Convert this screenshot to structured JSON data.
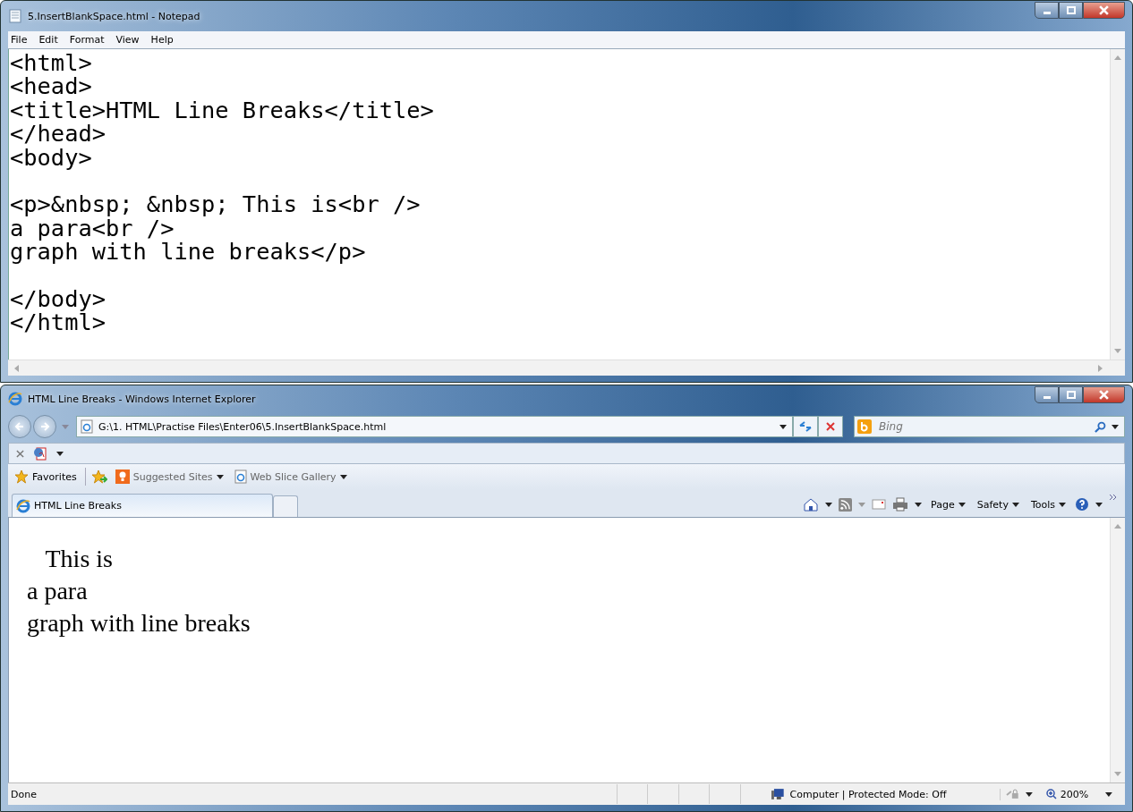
{
  "notepad": {
    "title": "5.InsertBlankSpace.html - Notepad",
    "menu": [
      "File",
      "Edit",
      "Format",
      "View",
      "Help"
    ],
    "code_blocks": [
      [
        "<html>",
        "<head>",
        "<title>HTML Line Breaks</title>",
        "</head>",
        "<body>"
      ],
      [
        "<p>&nbsp; &nbsp; This is<br />",
        "a para<br />",
        "graph with line breaks</p>"
      ],
      [
        "</body>",
        "</html>"
      ]
    ]
  },
  "browser": {
    "title": "HTML Line Breaks - Windows Internet Explorer",
    "address": "G:\\1. HTML\\Practise Files\\Enter06\\5.InsertBlankSpace.html",
    "search": {
      "placeholder": "Bing"
    },
    "favorites": {
      "label": "Favorites",
      "links": [
        "Suggested Sites",
        "Web Slice Gallery"
      ]
    },
    "tabs": [
      {
        "label": "HTML Line Breaks",
        "selected": true
      }
    ],
    "commands": [
      "Page",
      "Safety",
      "Tools"
    ],
    "content_lines": [
      "   This is",
      "a para",
      "graph with line breaks"
    ],
    "status": {
      "text": "Done",
      "zone": "Computer | Protected Mode: Off",
      "zoom": "200%"
    }
  }
}
